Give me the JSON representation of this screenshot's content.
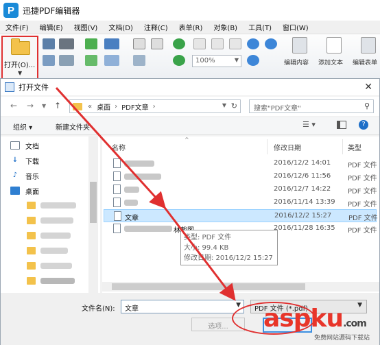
{
  "app": {
    "title": "迅捷PDF编辑器",
    "logo": "P"
  },
  "menu": [
    "文件(F)",
    "编辑(E)",
    "视图(V)",
    "文档(D)",
    "注释(C)",
    "表单(R)",
    "对象(B)",
    "工具(T)",
    "窗口(W)"
  ],
  "toolbar": {
    "open_label": "打开(O)...",
    "zoom": "100%",
    "edit_content": "编辑内容",
    "add_text": "添加文本",
    "edit_form": "编辑表单"
  },
  "dialog": {
    "title": "打开文件",
    "breadcrumb": [
      "«",
      "桌面",
      "›",
      "PDF文章",
      "›"
    ],
    "search_placeholder": "搜索\"PDF文章\"",
    "organize": "组织 ▾",
    "new_folder": "新建文件夹",
    "sidebar": [
      "文档",
      "下载",
      "音乐",
      "桌面"
    ],
    "columns": {
      "name": "名称",
      "date": "修改日期",
      "type": "类型"
    },
    "files": [
      {
        "name": "",
        "date": "2016/12/2 14:01",
        "type": "PDF 文件"
      },
      {
        "name": "",
        "date": "2016/12/6 11:56",
        "type": "PDF 文件"
      },
      {
        "name": "",
        "date": "2016/12/7 14:22",
        "type": "PDF 文件"
      },
      {
        "name": "",
        "date": "2016/11/14 13:39",
        "type": "PDF 文件"
      },
      {
        "name": "文章",
        "date": "2016/12/2 15:27",
        "type": "PDF 文件",
        "selected": true
      },
      {
        "name": "",
        "date": "2016/11/28 16:35",
        "type": "PDF 文件"
      }
    ],
    "row6_suffix": "林截图",
    "tooltip": [
      "类型: PDF 文件",
      "大小: 99.4 KB",
      "修改日期: 2016/12/2 15:27"
    ],
    "filename_label": "文件名(N):",
    "filename_value": "文章",
    "filetype": "PDF 文件 (*.pdf)",
    "options_button": "选项..."
  },
  "watermark": {
    "text": "aspku",
    "com": ".com",
    "sub": "免费网站源码下载站"
  },
  "colors": {
    "arrow": "#e03030",
    "accent": "#1a8ad8",
    "select": "#cce8ff"
  }
}
